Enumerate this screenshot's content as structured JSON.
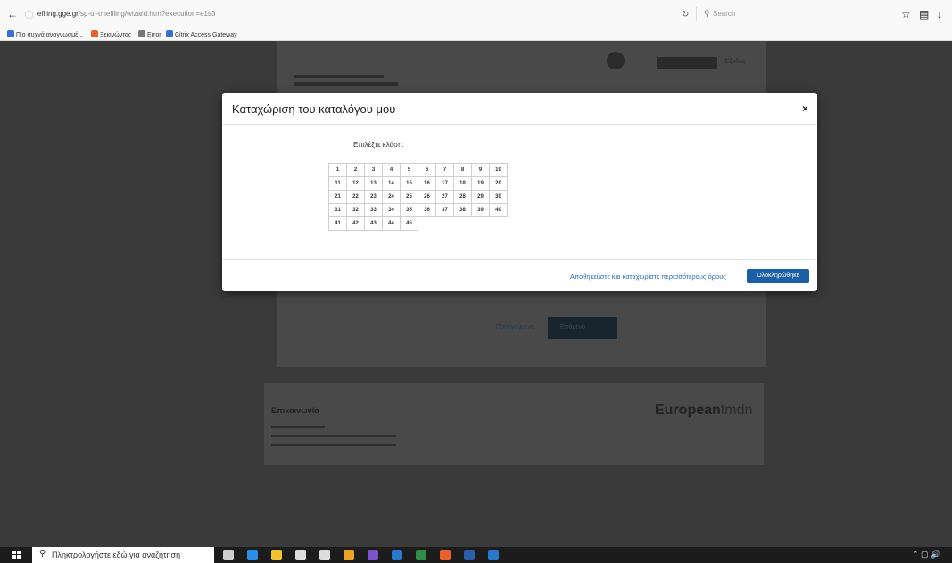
{
  "browser": {
    "url": "efiling.gge.gr/sp-ui-tmefiling/wizard.htm?execution=e1s3",
    "url_domain": "efiling.gge.gr",
    "url_prefix": "",
    "url_path": "/sp-ui-tmefiling/wizard.htm?execution=e1s3",
    "search_placeholder": "Search",
    "bookmarks": [
      {
        "label": "Πιο συχνά αναγνωσμέ...",
        "color": "#3b6fd6"
      },
      {
        "label": "Ξεκινώντας",
        "color": "#e8602c"
      },
      {
        "label": "Error",
        "color": "#777777"
      },
      {
        "label": "Citrix Access Gateway",
        "color": "#3b6fd6"
      }
    ]
  },
  "modal": {
    "title": "Καταχώριση του καταλόγου μου",
    "close_glyph": "×",
    "prompt": "Επιλέξτε κλάση:",
    "class_rows": [
      [
        "1",
        "2",
        "3",
        "4",
        "5",
        "6",
        "7",
        "8",
        "9",
        "10"
      ],
      [
        "11",
        "12",
        "13",
        "14",
        "15",
        "16",
        "17",
        "18",
        "19",
        "20"
      ],
      [
        "21",
        "22",
        "23",
        "24",
        "25",
        "26",
        "27",
        "28",
        "29",
        "30"
      ],
      [
        "31",
        "32",
        "33",
        "34",
        "35",
        "36",
        "37",
        "38",
        "39",
        "40"
      ],
      [
        "41",
        "42",
        "43",
        "44",
        "45"
      ]
    ],
    "save_more_link": "Αποθηκεύστε και καταχωρίστε περισσότερους όρους",
    "complete_button": "Ολοκληρώθηκε"
  },
  "background": {
    "exit_label": "Έξοδος",
    "prev_label": "Προηγούμενο",
    "next_label": "Επόμενο",
    "contact_title": "Επικοινωνία",
    "euro_logo_bold": "European",
    "euro_logo_light": "tmdn"
  },
  "taskbar": {
    "search_placeholder": "Πληκτρολογήστε εδώ για αναζήτηση",
    "apps": [
      {
        "name": "task-view-icon",
        "color": "#cfcfcf"
      },
      {
        "name": "edge-icon",
        "color": "#2b8ee6"
      },
      {
        "name": "file-explorer-icon",
        "color": "#f1c232"
      },
      {
        "name": "store-icon",
        "color": "#dddddd"
      },
      {
        "name": "mail-icon",
        "color": "#dddddd"
      },
      {
        "name": "chrome-icon",
        "color": "#e9a326"
      },
      {
        "name": "viber-icon",
        "color": "#7b52c9"
      },
      {
        "name": "outlook-icon",
        "color": "#2a78c9"
      },
      {
        "name": "excel-icon",
        "color": "#2e8b4a"
      },
      {
        "name": "firefox-icon",
        "color": "#e8602c"
      },
      {
        "name": "word-icon",
        "color": "#2a5ea9"
      },
      {
        "name": "outlook-icon-2",
        "color": "#2a78c9"
      }
    ]
  },
  "colors": {
    "primary_button": "#1b5fa4",
    "link": "#2a6ebb"
  }
}
